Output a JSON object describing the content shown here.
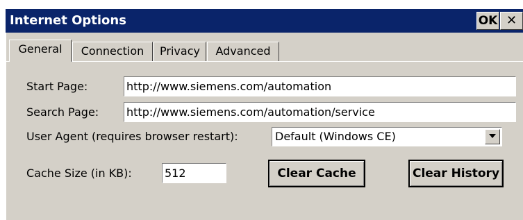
{
  "window": {
    "title": "Internet Options",
    "ok_label": "OK",
    "close_label": "✕"
  },
  "tabs": [
    {
      "label": "General",
      "active": true
    },
    {
      "label": "Connection",
      "active": false
    },
    {
      "label": "Privacy",
      "active": false
    },
    {
      "label": "Advanced",
      "active": false
    }
  ],
  "general": {
    "start_page": {
      "label": "Start Page:",
      "value": "http://www.siemens.com/automation"
    },
    "search_page": {
      "label": "Search Page:",
      "value": "http://www.siemens.com/automation/service"
    },
    "user_agent": {
      "label": "User Agent (requires browser restart):",
      "value": "Default (Windows CE)"
    },
    "cache_size": {
      "label": "Cache Size (in KB):",
      "value": "512"
    },
    "clear_cache_label": "Clear Cache",
    "clear_history_label": "Clear History"
  },
  "colors": {
    "titlebar": "#0a246a",
    "face": "#d4d0c8"
  }
}
